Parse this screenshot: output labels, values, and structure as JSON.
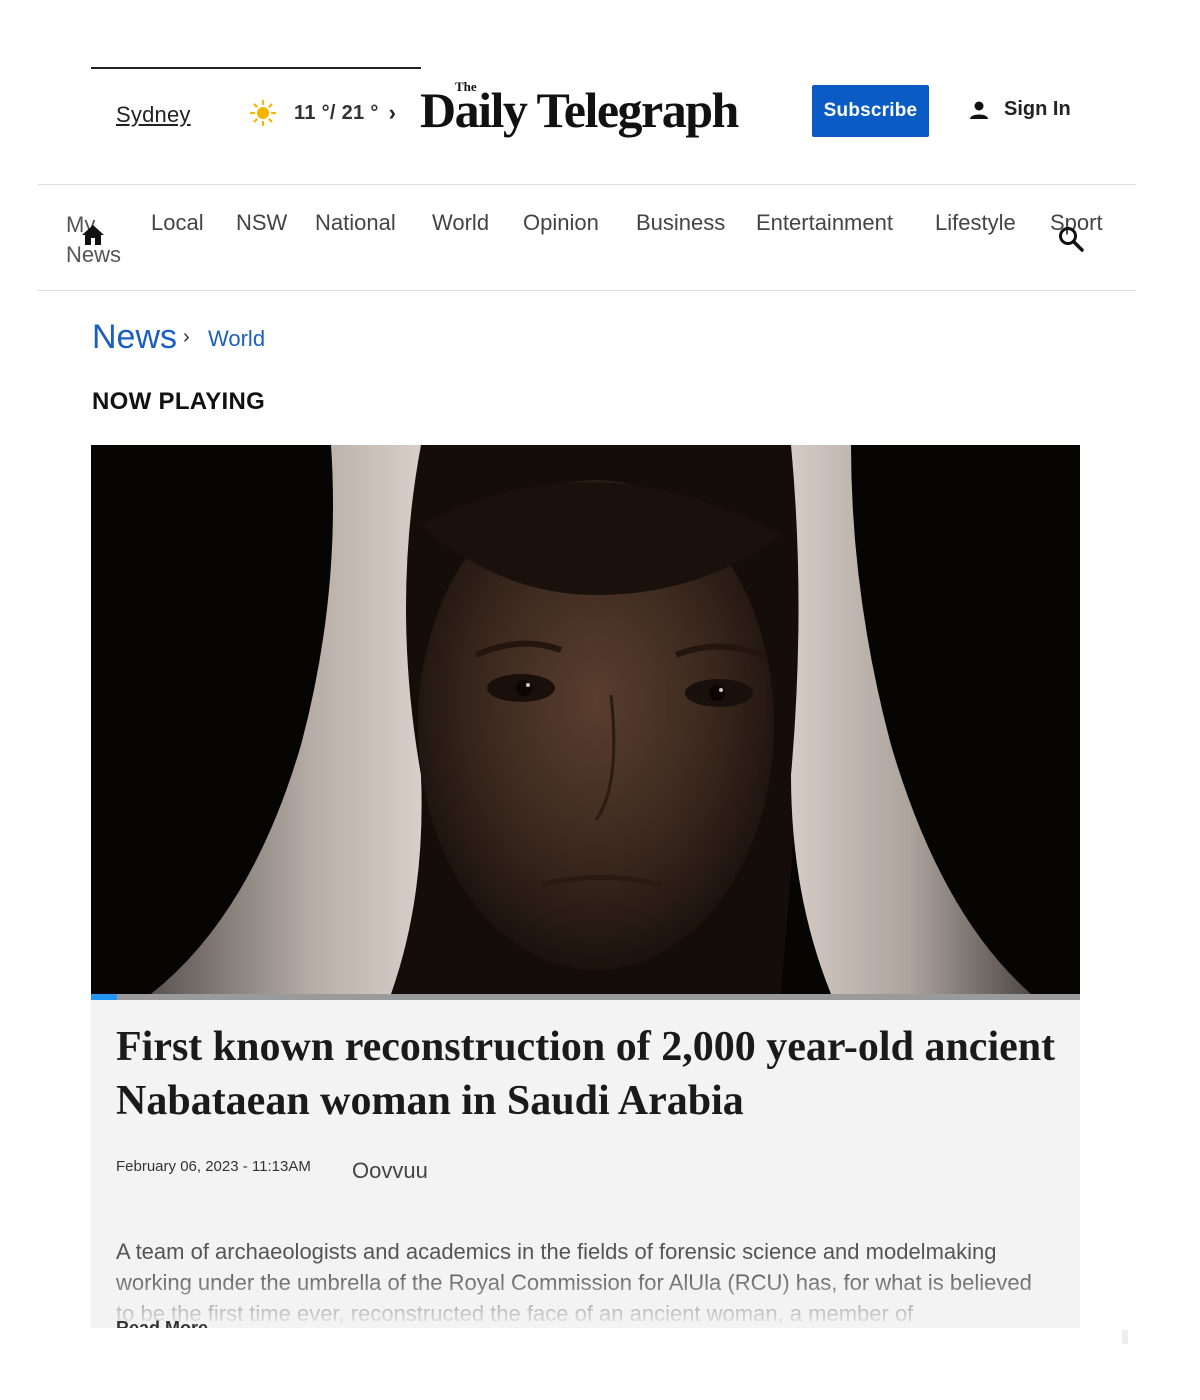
{
  "header": {
    "location": "Sydney",
    "weather": {
      "temps": "11 °/ 21 °",
      "icon": "sun-icon"
    },
    "masthead": {
      "the": "The",
      "name": "Daily Telegraph"
    },
    "subscribe_label": "Subscribe",
    "signin_label": "Sign In"
  },
  "nav": {
    "items": [
      "My News",
      "Local",
      "NSW",
      "National",
      "World",
      "Opinion",
      "Business",
      "Entertainment",
      "Lifestyle",
      "Sport"
    ]
  },
  "breadcrumb": {
    "section": "News",
    "separator": "›",
    "subsection": "World"
  },
  "video": {
    "label": "NOW PLAYING",
    "progress_percent": 2.6
  },
  "article": {
    "headline": "First known reconstruction of 2,000 year-old ancient Nabataean woman in Saudi Arabia",
    "date": "February 06, 2023 - 11:13AM",
    "source": "Oovvuu",
    "summary": "A team of archaeologists and academics in the fields of forensic science and modelmaking working under the umbrella of the Royal Commission for AlUla (RCU) has, for what is believed to be the first time ever, reconstructed the face of an ancient woman, a member of",
    "read_more": "Read More"
  },
  "colors": {
    "accent": "#0a5bc4",
    "link": "#1a5fc0",
    "progress": "#2196f3"
  }
}
